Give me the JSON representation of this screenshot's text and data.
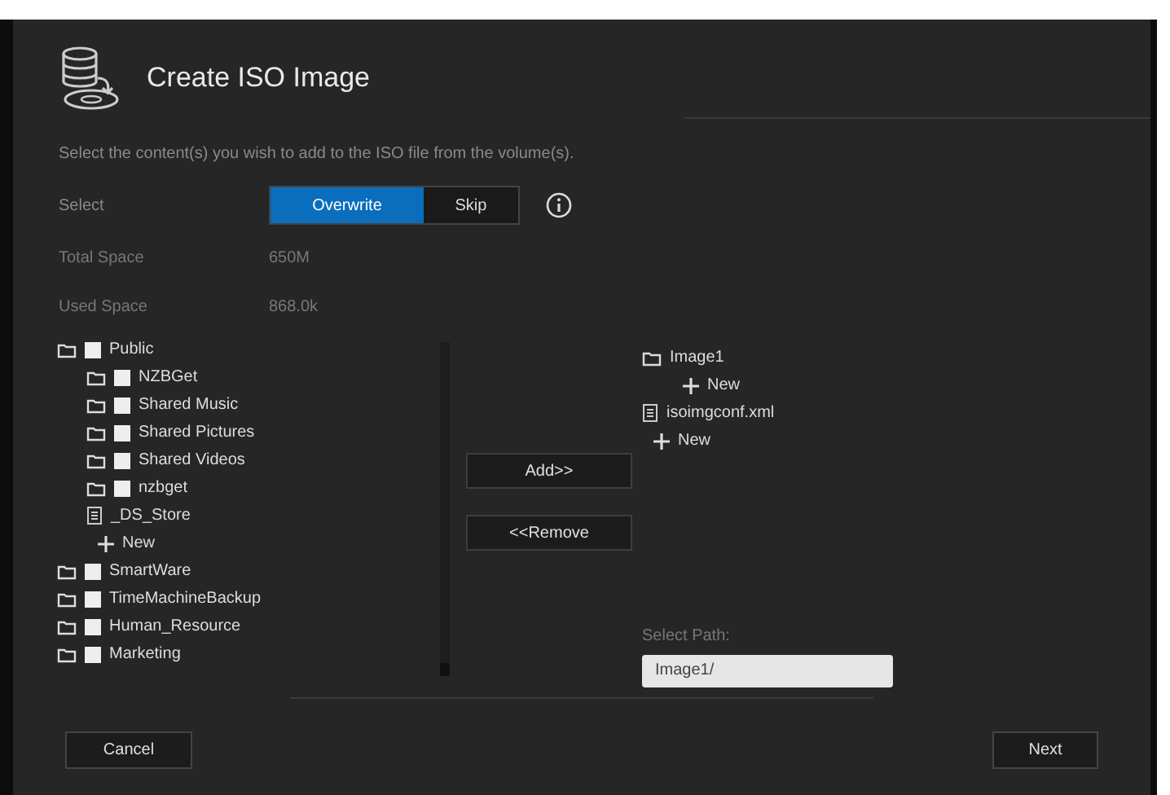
{
  "dialog": {
    "title": "Create ISO Image",
    "instruction": "Select the content(s) you wish to add to the ISO file from the volume(s)."
  },
  "select": {
    "label": "Select",
    "options": [
      {
        "label": "Overwrite",
        "selected": true
      },
      {
        "label": "Skip",
        "selected": false
      }
    ]
  },
  "info": [
    {
      "label": "Total Space",
      "value": "650M"
    },
    {
      "label": "Used Space",
      "value": "868.0k"
    }
  ],
  "source_tree": [
    {
      "kind": "folder",
      "name": "Public",
      "checked": false,
      "children": [
        {
          "kind": "folder",
          "name": "NZBGet",
          "checked": false
        },
        {
          "kind": "folder",
          "name": "Shared Music",
          "checked": false
        },
        {
          "kind": "folder",
          "name": "Shared Pictures",
          "checked": false
        },
        {
          "kind": "folder",
          "name": "Shared Videos",
          "checked": false
        },
        {
          "kind": "folder",
          "name": "nzbget",
          "checked": false
        },
        {
          "kind": "file",
          "name": "_DS_Store"
        },
        {
          "kind": "new",
          "name": "New"
        }
      ]
    },
    {
      "kind": "folder",
      "name": "SmartWare",
      "checked": false
    },
    {
      "kind": "folder",
      "name": "TimeMachineBackup",
      "checked": false
    },
    {
      "kind": "folder",
      "name": "Human_Resource",
      "checked": false
    },
    {
      "kind": "folder",
      "name": "Marketing",
      "checked": false
    }
  ],
  "actions": [
    "Add>>",
    "<<Remove"
  ],
  "target_tree": [
    {
      "kind": "folder",
      "name": "Image1",
      "children": [
        {
          "kind": "new",
          "name": "New"
        }
      ]
    },
    {
      "kind": "file",
      "name": "isoimgconf.xml"
    },
    {
      "kind": "new",
      "name": "New"
    }
  ],
  "select_path": {
    "label": "Select Path:",
    "value": "Image1/"
  },
  "footer": {
    "cancel": "Cancel",
    "next": "Next"
  }
}
